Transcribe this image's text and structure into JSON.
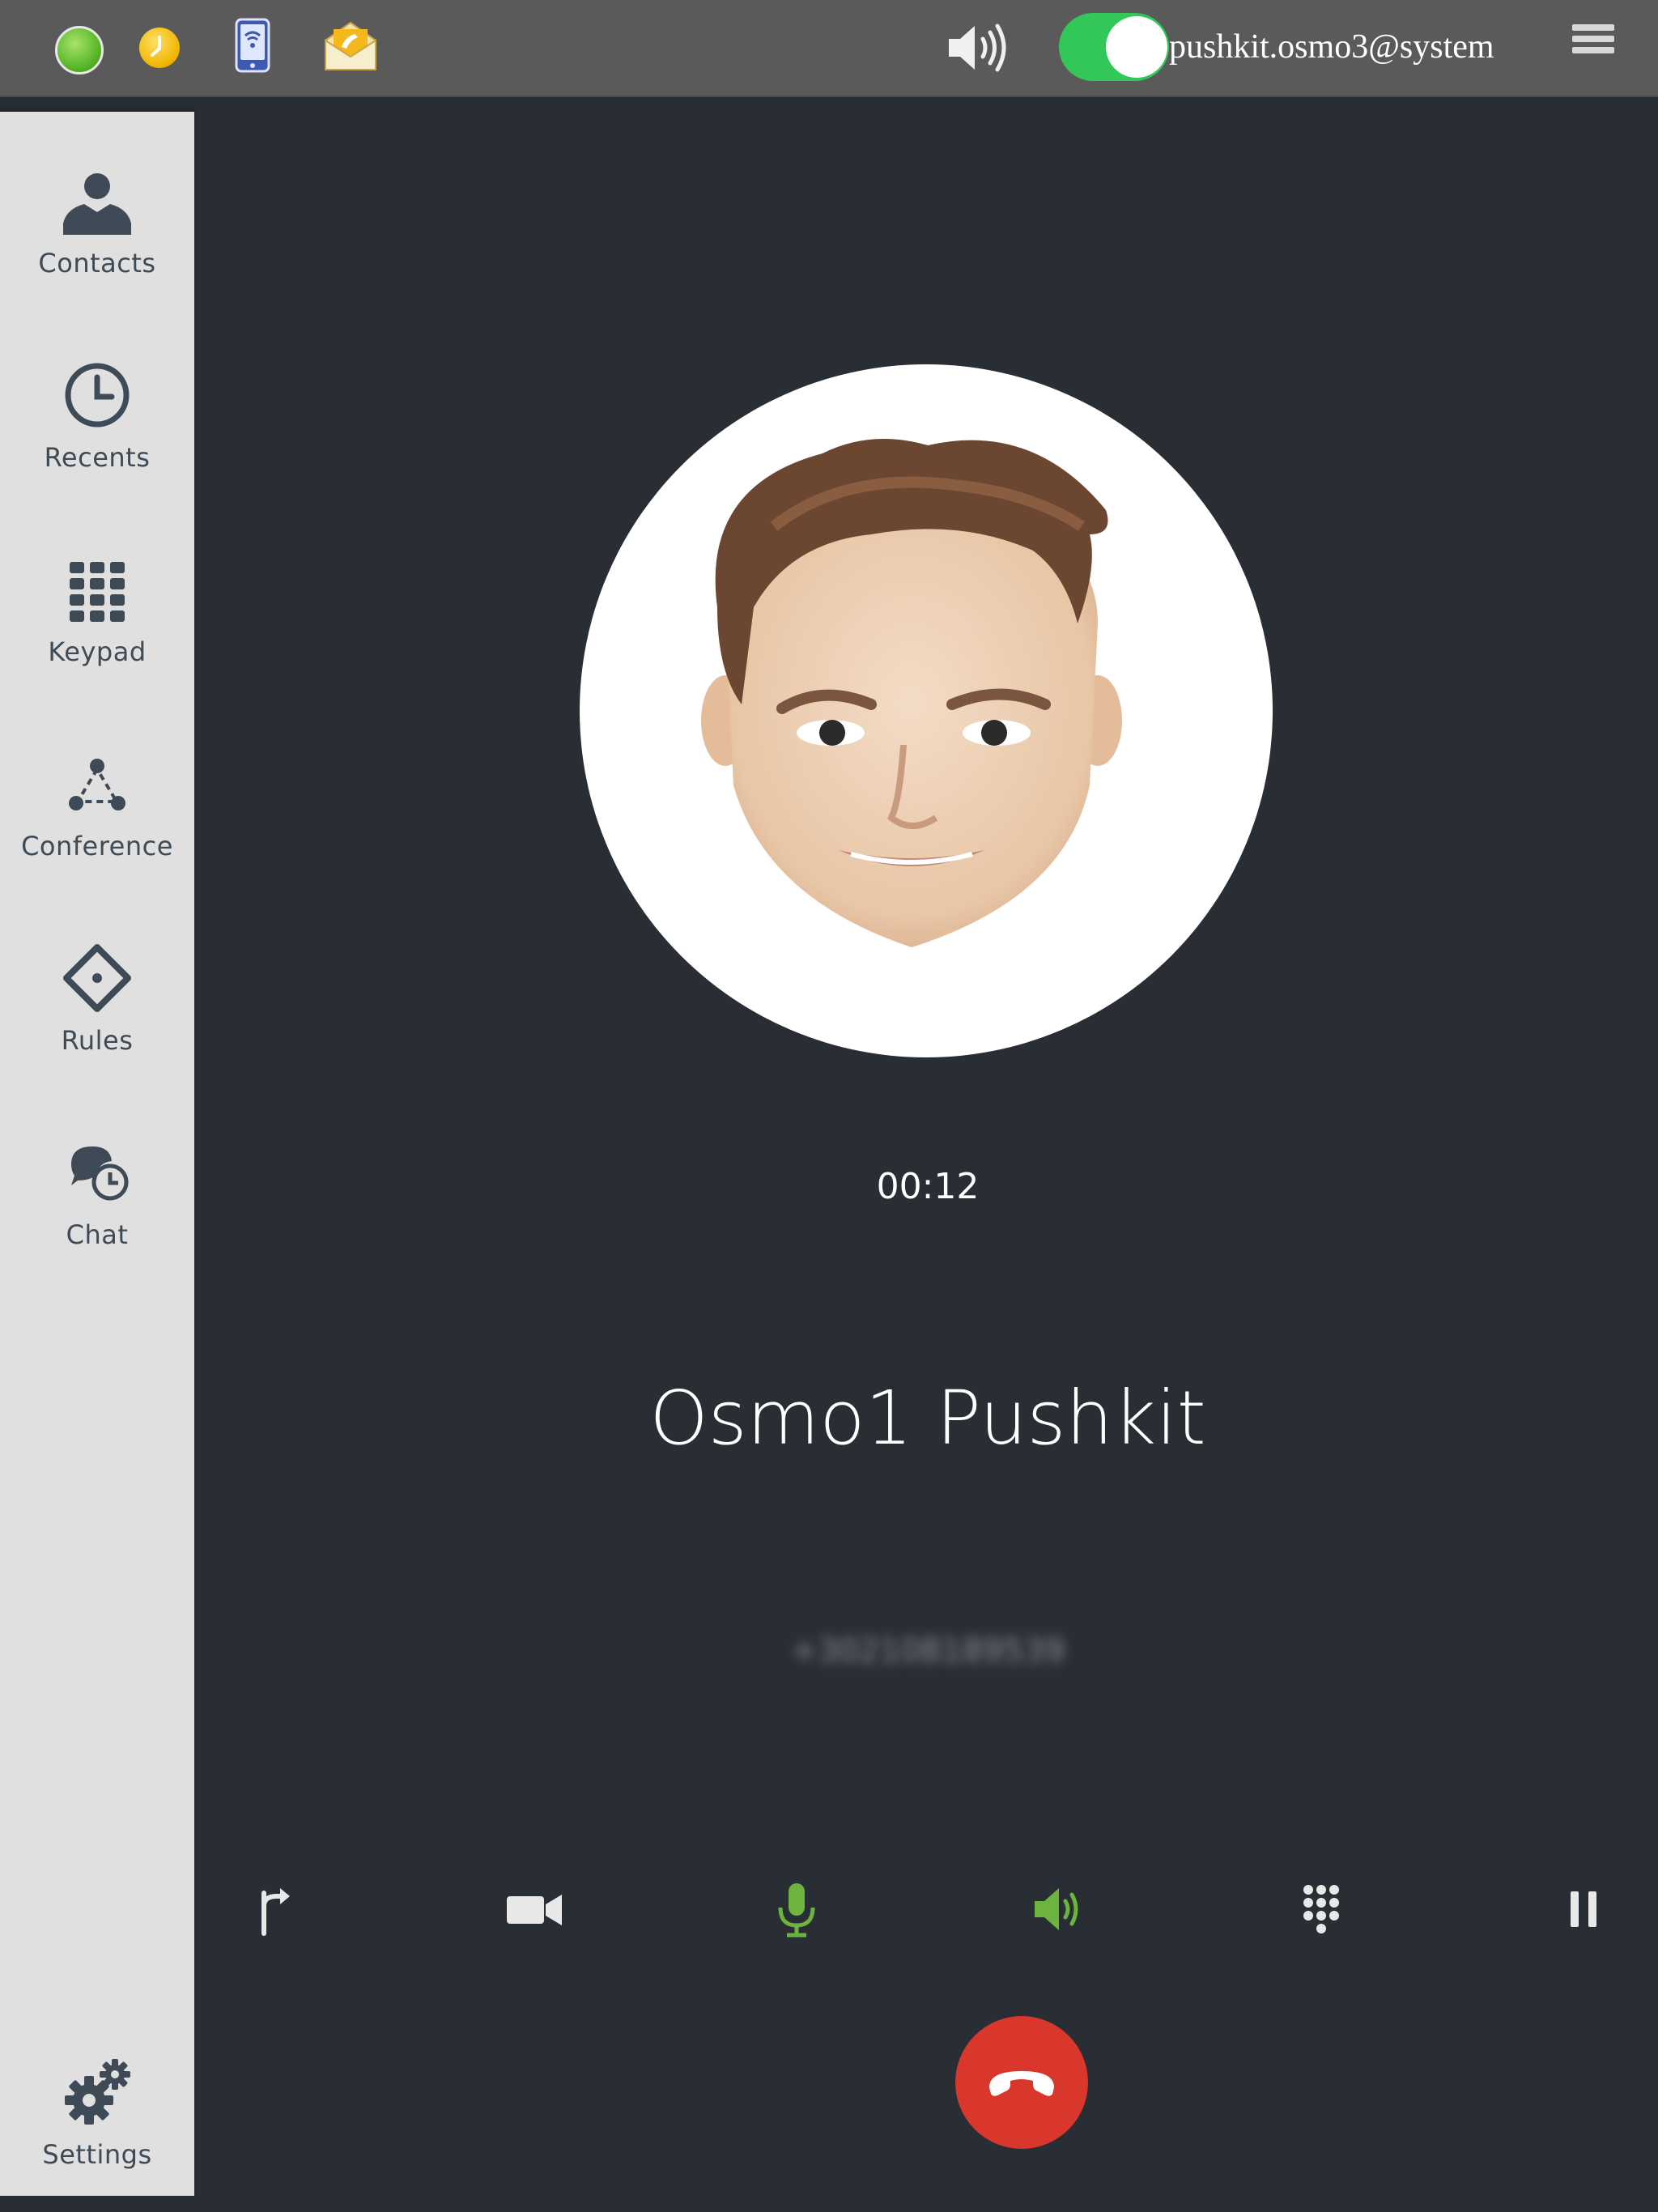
{
  "topbar": {
    "status_icons": [
      "online-status-icon",
      "away-status-icon"
    ],
    "apps": [
      "phone-app-icon",
      "mail-app-icon"
    ],
    "speaker_icon": "speaker-volume-icon",
    "toggle_on": true,
    "account": "pushkit.osmo3@system",
    "menu_icon": "hamburger-menu-icon"
  },
  "sidebar": {
    "items": [
      {
        "label": "Contacts",
        "icon": "person-icon"
      },
      {
        "label": "Recents",
        "icon": "clock-icon"
      },
      {
        "label": "Keypad",
        "icon": "keypad-grid-icon"
      },
      {
        "label": "Conference",
        "icon": "conference-triangle-icon"
      },
      {
        "label": "Rules",
        "icon": "rules-diamond-icon"
      },
      {
        "label": "Chat",
        "icon": "chat-history-icon"
      }
    ],
    "settings": {
      "label": "Settings",
      "icon": "gears-icon"
    }
  },
  "call": {
    "timer": "00:12",
    "name": "Osmo1 Pushkit",
    "number": "+302108189539"
  },
  "controls": [
    {
      "name": "transfer-icon"
    },
    {
      "name": "video-camera-icon"
    },
    {
      "name": "microphone-icon"
    },
    {
      "name": "speaker-active-icon"
    },
    {
      "name": "dialpad-icon"
    },
    {
      "name": "pause-icon"
    }
  ],
  "colors": {
    "background": "#292e35",
    "sidebar": "#e0e0e0",
    "topbar": "#5a5a5a",
    "toggle": "#33c759",
    "active_control": "#6db33f",
    "hangup": "#d9362c"
  }
}
